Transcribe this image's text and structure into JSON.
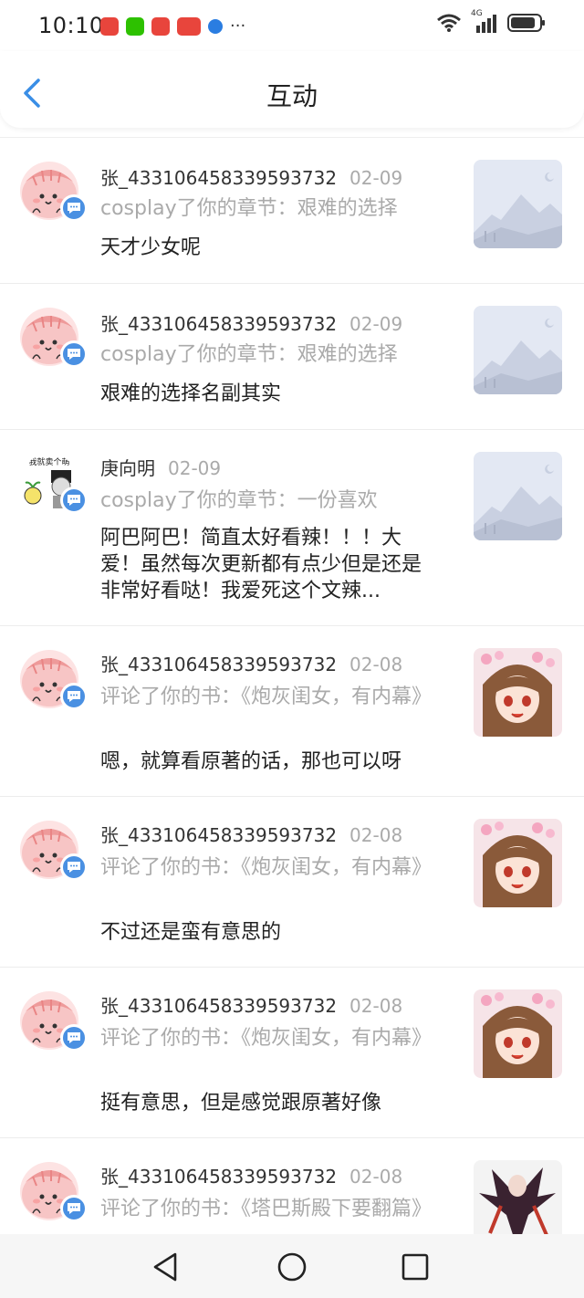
{
  "status_bar": {
    "time": "10:10",
    "overflow": "···",
    "network": "4G"
  },
  "header": {
    "title": "互动"
  },
  "items": [
    {
      "user": "张_433106458339593732",
      "date": "02-09",
      "action": "cosplay了你的章节：艰难的选择",
      "content": "天才少女呢"
    },
    {
      "user": "张_433106458339593732",
      "date": "02-09",
      "action": "cosplay了你的章节：艰难的选择",
      "content": "艰难的选择名副其实"
    },
    {
      "user": "庚向明",
      "date": "02-09",
      "action": "cosplay了你的章节：一份喜欢",
      "content": "阿巴阿巴！简直太好看辣！！！大爱！虽然每次更新都有点少但是还是非常好看哒！我爱死这个文辣..."
    },
    {
      "user": "张_433106458339593732",
      "date": "02-08",
      "action": "评论了你的书：《炮灰闺女，有内幕》",
      "content": "嗯，就算看原著的话，那也可以呀"
    },
    {
      "user": "张_433106458339593732",
      "date": "02-08",
      "action": "评论了你的书：《炮灰闺女，有内幕》",
      "content": "不过还是蛮有意思的"
    },
    {
      "user": "张_433106458339593732",
      "date": "02-08",
      "action": "评论了你的书：《炮灰闺女，有内幕》",
      "content": "挺有意思，但是感觉跟原著好像"
    },
    {
      "user": "张_433106458339593732",
      "date": "02-08",
      "action": "评论了你的书：《塔巴斯殿下要翻篇》",
      "content": ""
    }
  ],
  "avatar_meme_text": "我就卖个萌",
  "colors": {
    "accent": "#3a8ee6",
    "badge": "#4a90e2",
    "muted": "#aaaaaa"
  }
}
